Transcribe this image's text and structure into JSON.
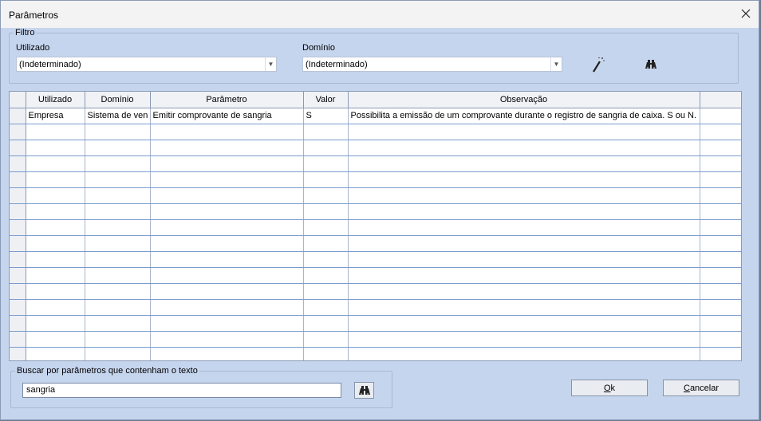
{
  "window": {
    "title": "Parâmetros"
  },
  "filter": {
    "legend": "Filtro",
    "utilizado_label": "Utilizado",
    "utilizado_value": "(Indeterminado)",
    "dominio_label": "Domínio",
    "dominio_value": "(Indeterminado)"
  },
  "icons": {
    "wand": "magic-wand-icon",
    "search": "binoculars-icon",
    "close": "close-icon"
  },
  "grid": {
    "columns": [
      "Utilizado",
      "Domínio",
      "Parâmetro",
      "Valor",
      "Observação"
    ],
    "rows": [
      {
        "utilizado": "Empresa",
        "dominio": "Sistema de ven",
        "parametro": "Emitir comprovante de sangria",
        "valor": "S",
        "observacao": "Possibilita a emissão de um comprovante durante o registro de sangria de caixa. S ou N."
      }
    ]
  },
  "search": {
    "legend": "Buscar por parâmetros que contenham o texto",
    "value": "sangria"
  },
  "buttons": {
    "ok_accel": "O",
    "ok_rest": "k",
    "cancel_accel": "C",
    "cancel_rest": "ancelar"
  }
}
